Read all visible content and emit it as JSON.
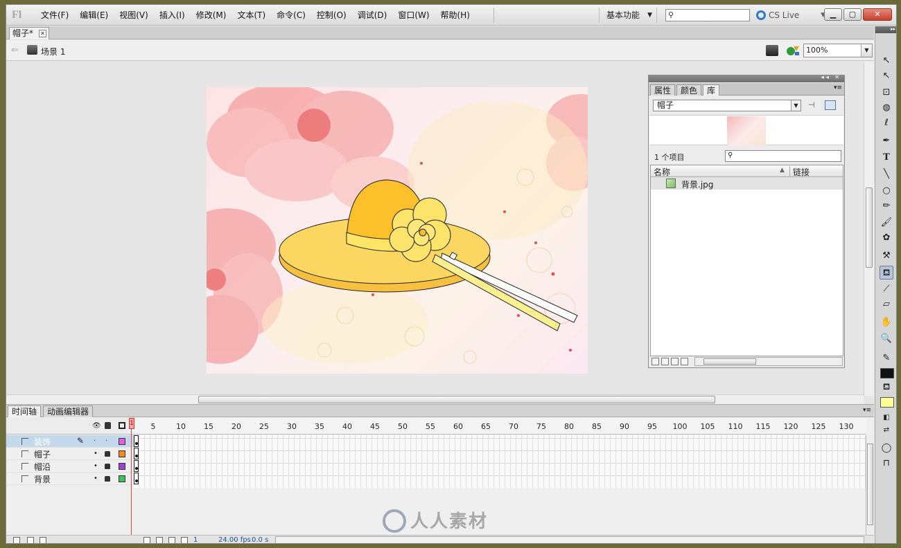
{
  "app": {
    "logo": "Fl"
  },
  "menu": [
    "文件(F)",
    "编辑(E)",
    "视图(V)",
    "插入(I)",
    "修改(M)",
    "文本(T)",
    "命令(C)",
    "控制(O)",
    "调试(D)",
    "窗口(W)",
    "帮助(H)"
  ],
  "workspace": {
    "label": "基本功能"
  },
  "search": {
    "placeholder": ""
  },
  "cslive": {
    "label": "CS Live"
  },
  "doc_tab": {
    "label": "帽子*"
  },
  "scene": {
    "label": "场景 1"
  },
  "zoom": {
    "value": "100%"
  },
  "library": {
    "tabs": [
      "属性",
      "颜色",
      "库"
    ],
    "active_tab": "库",
    "document": "帽子",
    "item_count": "1 个项目",
    "columns": {
      "name": "名称",
      "linkage": "链接"
    },
    "items": [
      {
        "name": "背景.jpg"
      }
    ]
  },
  "timeline": {
    "tabs": [
      "时间轴",
      "动画编辑器"
    ],
    "frame_numbers": [
      "1",
      "5",
      "10",
      "15",
      "20",
      "25",
      "30",
      "35",
      "40",
      "45",
      "50",
      "55",
      "60",
      "65",
      "70",
      "75",
      "80",
      "85",
      "90",
      "95",
      "100",
      "105",
      "110",
      "115",
      "120",
      "125",
      "130"
    ],
    "layers": [
      {
        "name": "装饰",
        "color": "#e060e0",
        "selected": true
      },
      {
        "name": "帽子",
        "color": "#f08a20",
        "selected": false
      },
      {
        "name": "帽沿",
        "color": "#a040d0",
        "selected": false
      },
      {
        "name": "背景",
        "color": "#40c060",
        "selected": false
      }
    ],
    "current_frame": "1",
    "fps": "24.00 fps",
    "time": "0.0 s"
  },
  "colors": {
    "stroke": "#111111",
    "fill": "#ffff99"
  },
  "watermark": {
    "text": "人人素材"
  }
}
